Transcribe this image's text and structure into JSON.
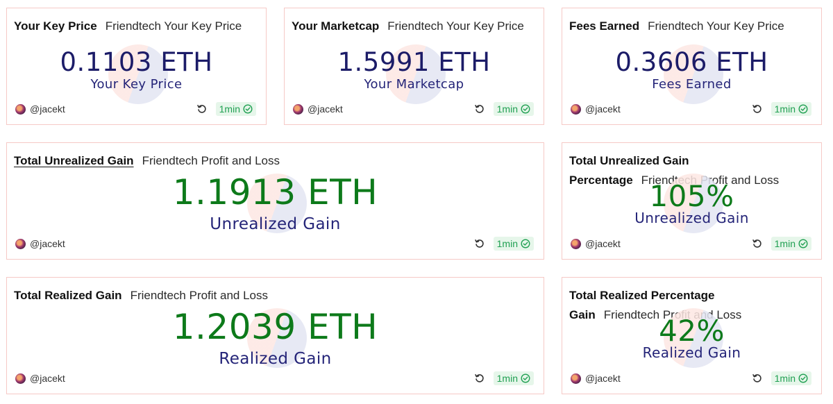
{
  "cards": {
    "key_price": {
      "title": "Your Key Price",
      "subtitle": "Friendtech Your Key Price",
      "value": "0.1103 ETH",
      "caption": "Your Key Price",
      "user": "@jacekt",
      "refresh": "1min"
    },
    "marketcap": {
      "title": "Your Marketcap",
      "subtitle": "Friendtech Your Key Price",
      "value": "1.5991 ETH",
      "caption": "Your Marketcap",
      "user": "@jacekt",
      "refresh": "1min"
    },
    "fees": {
      "title": "Fees Earned",
      "subtitle": "Friendtech Your Key Price",
      "value": "0.3606 ETH",
      "caption": "Fees Earned",
      "user": "@jacekt",
      "refresh": "1min"
    },
    "unrealized": {
      "title": "Total Unrealized Gain",
      "subtitle": "Friendtech Profit and Loss",
      "value": "1.1913 ETH",
      "caption": "Unrealized Gain",
      "user": "@jacekt",
      "refresh": "1min"
    },
    "unrealized_pct": {
      "title": "Total Unrealized Gain",
      "title2": "Percentage",
      "subtitle": "Friendtech Profit and Loss",
      "value": "105%",
      "caption": "Unrealized Gain",
      "user": "@jacekt",
      "refresh": "1min"
    },
    "realized": {
      "title": "Total Realized Gain",
      "subtitle": "Friendtech Profit and Loss",
      "value": "1.2039 ETH",
      "caption": "Realized Gain",
      "user": "@jacekt",
      "refresh": "1min"
    },
    "realized_pct": {
      "title": "Total Realized Percentage",
      "title2": "Gain",
      "subtitle": "Friendtech Profit and Loss",
      "value": "42%",
      "caption": "Realized Gain",
      "user": "@jacekt",
      "refresh": "1min"
    }
  },
  "colors": {
    "value_navy": "#1c1c68",
    "value_green": "#0d7a1a",
    "card_border": "#f6c9c6",
    "badge_bg": "#e6f6ea",
    "badge_text": "#20a052"
  },
  "icons": {
    "refresh": "refresh-icon",
    "check": "check-circle-icon",
    "avatar": "avatar"
  }
}
